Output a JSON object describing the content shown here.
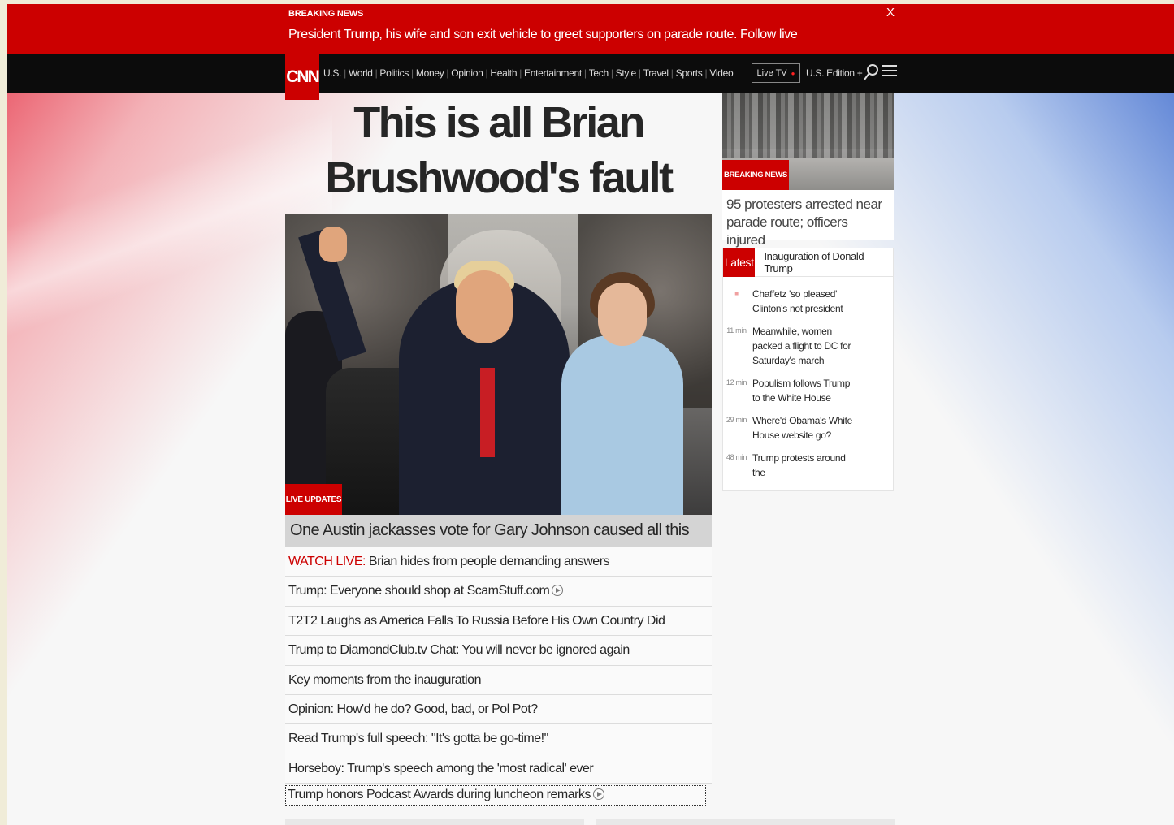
{
  "breaking": {
    "label": "BREAKING NEWS",
    "text": "President Trump, his wife and son exit vehicle to greet supporters on parade route. Follow live",
    "close": "X"
  },
  "nav": {
    "logo": "CNN",
    "links": [
      "U.S.",
      "World",
      "Politics",
      "Money",
      "Opinion",
      "Health",
      "Entertainment",
      "Tech",
      "Style",
      "Travel",
      "Sports",
      "Video"
    ],
    "live_tv": "Live TV",
    "edition": "U.S. Edition +"
  },
  "main": {
    "headline": "This is all Brian Brushwood's fault",
    "badge": "LIVE UPDATES",
    "caption": "One Austin jackasses vote for Gary Johnson caused all this",
    "stories": [
      {
        "prefix": "WATCH LIVE:",
        "text": " Brian hides from people demanding answers",
        "video": false
      },
      {
        "prefix": "",
        "text": "Trump: Everyone should shop at ScamStuff.com",
        "video": true
      },
      {
        "prefix": "",
        "text": "T2T2 Laughs as America Falls To Russia Before His Own Country Did",
        "video": false
      },
      {
        "prefix": "",
        "text": "Trump to DiamondClub.tv Chat: You will never be ignored again",
        "video": false
      },
      {
        "prefix": "",
        "text": "Key moments from the inauguration",
        "video": false
      },
      {
        "prefix": "",
        "text": "Opinion: How'd he do? Good, bad, or Pol Pot?",
        "video": false
      },
      {
        "prefix": "",
        "text": "Read Trump's full speech: \"It's gotta be go-time!\"",
        "video": false
      },
      {
        "prefix": "",
        "text": "Horseboy: Trump's speech among the 'most radical' ever",
        "video": false
      },
      {
        "prefix": "",
        "text": "Trump honors Podcast Awards during luncheon remarks",
        "video": true
      }
    ]
  },
  "side": {
    "badge": "BREAKING NEWS",
    "headline": "95 protesters arrested near parade route; officers injured",
    "latest_tab": "Latest",
    "topic": "Inauguration of Donald Trump",
    "timeline": [
      {
        "time": "",
        "text": "Chaffetz 'so pleased' Clinton's not president"
      },
      {
        "time": "11 min",
        "text": "Meanwhile, women packed a flight to DC for Saturday's march"
      },
      {
        "time": "12 min",
        "text": "Populism follows Trump to the White House"
      },
      {
        "time": "29 min",
        "text": "Where'd Obama's White House website go?"
      },
      {
        "time": "48 min",
        "text": "Trump protests around the"
      }
    ]
  },
  "colors": {
    "brand_red": "#cc0000",
    "nav_bg": "#0c0c0c"
  }
}
